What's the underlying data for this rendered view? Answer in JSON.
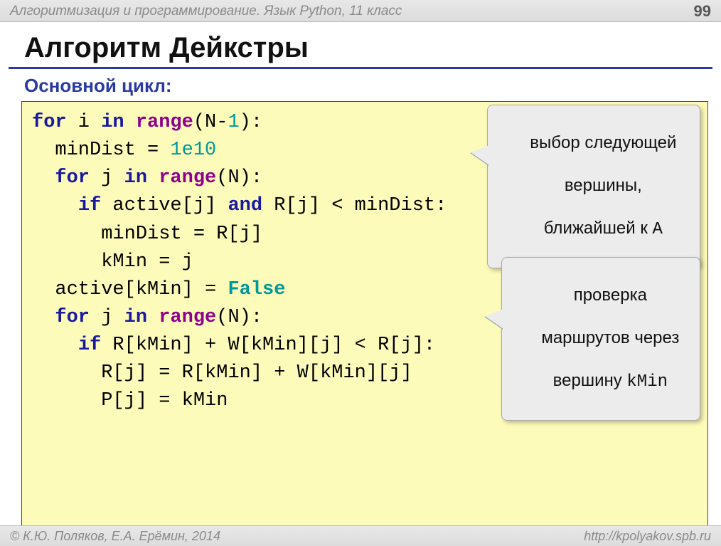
{
  "header": {
    "course": "Алгоритмизация и программирование. Язык Python, 11 класс",
    "page": "99"
  },
  "title": "Алгоритм Дейкстры",
  "subtitle": "Основной цикл:",
  "code": {
    "l1a": "for",
    "l1b": " i ",
    "l1c": "in",
    "l1d": " ",
    "l1e": "range",
    "l1f": "(N-",
    "l1g": "1",
    "l1h": "):",
    "l2a": "  minDist = ",
    "l2b": "1e10",
    "l3a": "  ",
    "l3b": "for",
    "l3c": " j ",
    "l3d": "in",
    "l3e": " ",
    "l3f": "range",
    "l3g": "(N):",
    "l4a": "    ",
    "l4b": "if",
    "l4c": " active[j] ",
    "l4d": "and",
    "l4e": " R[j] < minDist:",
    "l5": "      minDist = R[j]",
    "l6": "      kMin = j",
    "l7a": "  active[kMin] = ",
    "l7b": "False",
    "l8a": "  ",
    "l8b": "for",
    "l8c": " j ",
    "l8d": "in",
    "l8e": " ",
    "l8f": "range",
    "l8g": "(N):",
    "l9a": "    ",
    "l9b": "if",
    "l9c": " R[kMin] + W[kMin][j] < R[j]:",
    "l10": "      R[j] = R[kMin] + W[kMin][j]",
    "l11": "      P[j] = kMin"
  },
  "callouts": {
    "c1_l1": "выбор следующей",
    "c1_l2": "вершины,",
    "c1_l3a": "ближайшей к ",
    "c1_l3b": "A",
    "c2_l1": "проверка",
    "c2_l2": "маршрутов через",
    "c2_l3a": "вершину ",
    "c2_l3b": "kMin"
  },
  "footer": {
    "left": "© К.Ю. Поляков, Е.А. Ерёмин, 2014",
    "right": "http://kpolyakov.spb.ru"
  }
}
